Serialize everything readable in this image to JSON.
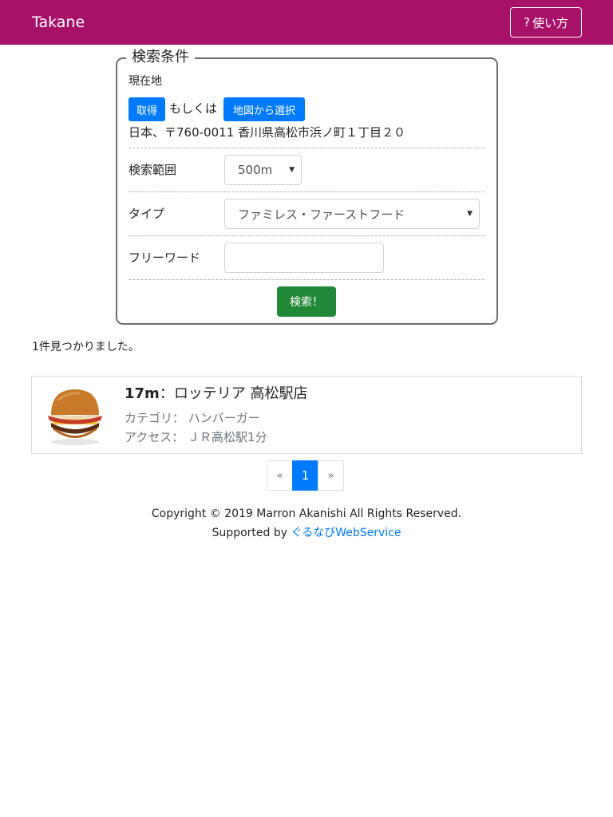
{
  "navbar": {
    "brand": "Takane",
    "help_icon_char": "?",
    "help_label": "使い方",
    "bg_color": "#a81168"
  },
  "search": {
    "legend": "検索条件",
    "location_label": "現在地",
    "get_button": "取得",
    "or_text": "もしくは",
    "map_button": "地図から選択",
    "address": "日本、〒760-0011 香川県高松市浜ノ町１丁目２０",
    "range_label": "検索範囲",
    "range_value": "500m",
    "type_label": "タイプ",
    "type_value": "ファミレス・ファーストフード",
    "freeword_label": "フリーワード",
    "freeword_value": "",
    "submit_button": "検索！"
  },
  "results": {
    "count_text": "1件見つかりました。",
    "items": [
      {
        "distance": "17m",
        "separator": "：",
        "name": "ロッテリア 高松駅店",
        "category_label": "カテゴリ：",
        "category": "ハンバーガー",
        "access_label": "アクセス：",
        "access": "ＪＲ高松駅1分",
        "image": "hamburger-photo"
      }
    ]
  },
  "pagination": {
    "prev": "«",
    "pages": [
      "1"
    ],
    "current": "1",
    "next": "»"
  },
  "footer": {
    "copyright": "Copyright © 2019 Marron Akanishi All Rights Reserved.",
    "supported_prefix": "Supported by ",
    "supported_link": "ぐるなびWebService"
  },
  "colors": {
    "primary": "#007bff",
    "success": "#218838",
    "brand": "#a81168"
  }
}
